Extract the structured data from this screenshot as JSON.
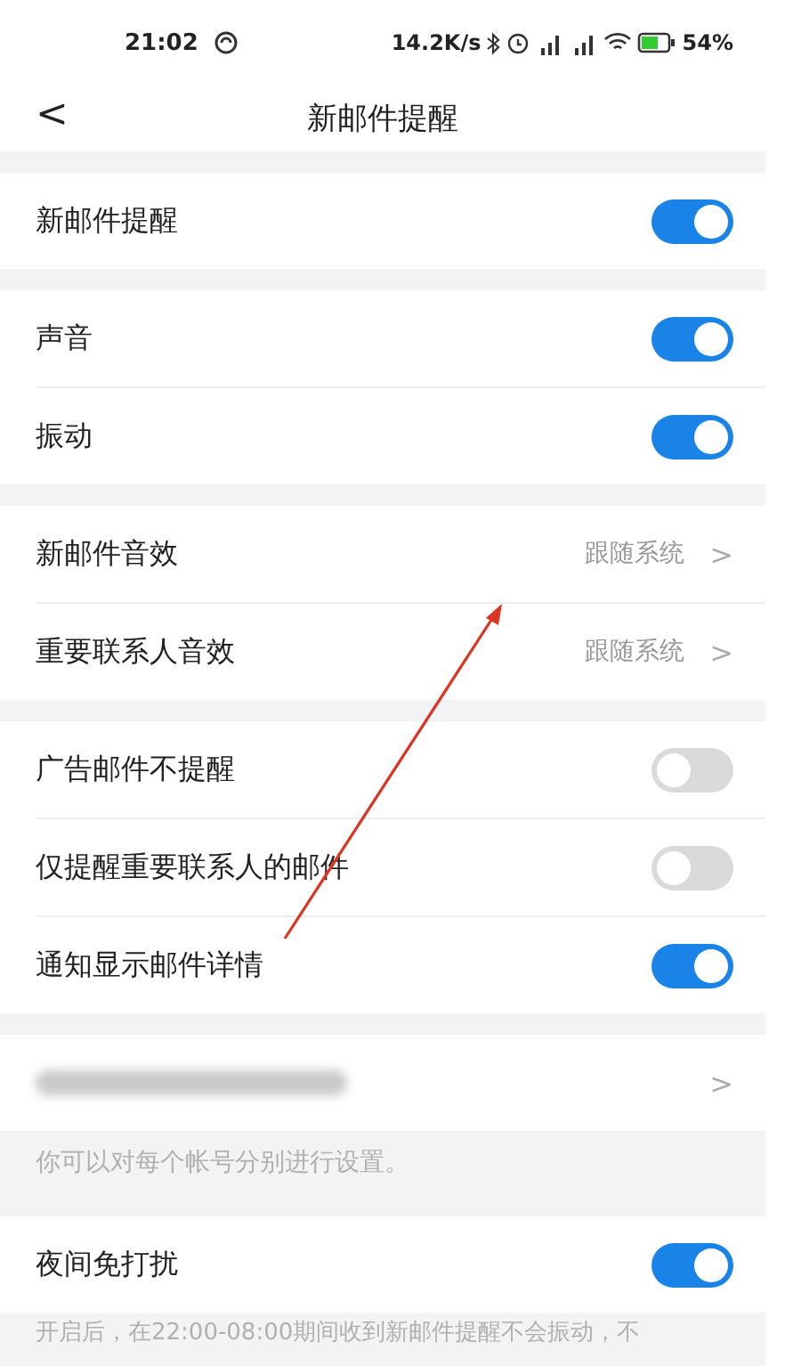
{
  "status_bar": {
    "time": "21:02",
    "speed": "14.2K/s",
    "battery": "54%"
  },
  "header": {
    "back": "<",
    "title": "新邮件提醒"
  },
  "groups": [
    {
      "rows": [
        {
          "kind": "toggle",
          "label": "新邮件提醒",
          "on": true
        }
      ]
    },
    {
      "rows": [
        {
          "kind": "toggle",
          "label": "声音",
          "on": true
        },
        {
          "kind": "toggle",
          "label": "振动",
          "on": true
        }
      ]
    },
    {
      "rows": [
        {
          "kind": "link",
          "label": "新邮件音效",
          "value": "跟随系统",
          "chevron": ">"
        },
        {
          "kind": "link",
          "label": "重要联系人音效",
          "value": "跟随系统",
          "chevron": ">"
        }
      ]
    },
    {
      "rows": [
        {
          "kind": "toggle",
          "label": "广告邮件不提醒",
          "on": false
        },
        {
          "kind": "toggle",
          "label": "仅提醒重要联系人的邮件",
          "on": false
        },
        {
          "kind": "toggle",
          "label": "通知显示邮件详情",
          "on": true
        }
      ]
    },
    {
      "rows": [
        {
          "kind": "account",
          "chevron": ">"
        }
      ],
      "note": "你可以对每个帐号分别进行设置。"
    },
    {
      "rows": [
        {
          "kind": "toggle",
          "label": "夜间免打扰",
          "on": true
        }
      ],
      "note": "开启后，在22:00-08:00期间收到新邮件提醒不会振动，不"
    }
  ]
}
